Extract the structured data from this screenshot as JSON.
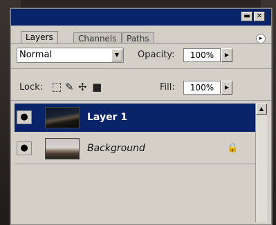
{
  "panel": {
    "titlebar": {
      "minimize_glyph": "▬",
      "close_glyph": "✕"
    },
    "tabs": [
      {
        "label": "Layers",
        "active": true
      },
      {
        "label": "Channels",
        "active": false
      },
      {
        "label": "Paths",
        "active": false
      }
    ],
    "menu_glyph": "▸"
  },
  "controls": {
    "blend_mode": "Normal",
    "opacity_label": "Opacity:",
    "opacity_value": "100%",
    "lock_label": "Lock:",
    "fill_label": "Fill:",
    "fill_value": "100%",
    "dropdown_glyph": "▼",
    "arrow_glyph": "▶"
  },
  "layers": [
    {
      "name": "Layer 1",
      "selected": true,
      "eye_glyph": "●",
      "locked": false
    },
    {
      "name": "Background",
      "selected": false,
      "eye_glyph": "●",
      "locked": true,
      "lock_glyph": "🔒"
    }
  ],
  "icons": {
    "lock_transparent": "transparency-lock-icon",
    "lock_brush": "brush-lock-icon",
    "lock_move": "move-lock-icon",
    "lock_all": "lock-all-icon"
  },
  "colors": {
    "titlebar": "#0a246a",
    "selection": "#0a246a",
    "panel_bg": "#d4d0c8"
  }
}
